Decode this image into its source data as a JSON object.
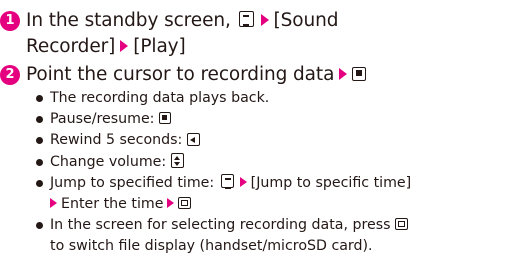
{
  "colors": {
    "accent": "#e4007f",
    "text": "#231815"
  },
  "steps": [
    {
      "number": "1",
      "line1_prefix": "In the standby screen,",
      "line1_menu": "[Sound",
      "line2": "Recorder]",
      "line2_tail": "[Play]",
      "icons": [
        "menu-key-icon",
        "arrow-icon"
      ]
    },
    {
      "number": "2",
      "text": "Point the cursor to recording data",
      "icons": [
        "arrow-icon",
        "center-key-icon"
      ]
    }
  ],
  "bullets": {
    "b1": "The recording data plays back.",
    "b2": "Pause/resume:",
    "b3": "Rewind 5 seconds:",
    "b4": "Change volume:",
    "b5a": "Jump to specified time:",
    "b5b": "[Jump to specific time]",
    "b5c": "Enter the time",
    "b6a": "In the screen for selecting recording data, press",
    "b6b": "to switch file display (handset/microSD card)."
  }
}
